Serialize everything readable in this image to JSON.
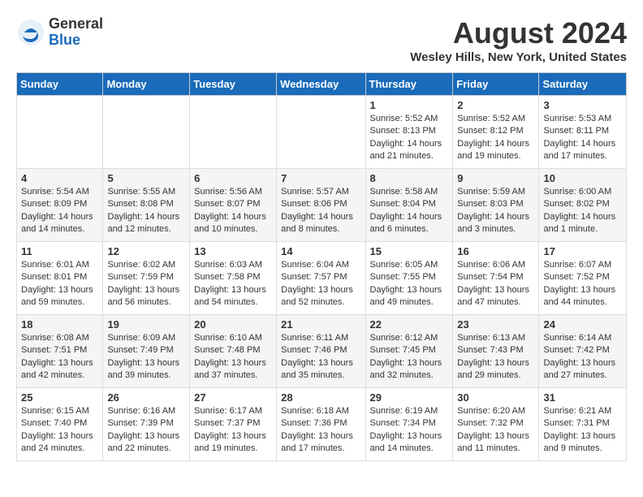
{
  "logo": {
    "general": "General",
    "blue": "Blue"
  },
  "title": "August 2024",
  "location": "Wesley Hills, New York, United States",
  "days_of_week": [
    "Sunday",
    "Monday",
    "Tuesday",
    "Wednesday",
    "Thursday",
    "Friday",
    "Saturday"
  ],
  "weeks": [
    [
      {
        "day": "",
        "content": ""
      },
      {
        "day": "",
        "content": ""
      },
      {
        "day": "",
        "content": ""
      },
      {
        "day": "",
        "content": ""
      },
      {
        "day": "1",
        "content": "Sunrise: 5:52 AM\nSunset: 8:13 PM\nDaylight: 14 hours and 21 minutes."
      },
      {
        "day": "2",
        "content": "Sunrise: 5:52 AM\nSunset: 8:12 PM\nDaylight: 14 hours and 19 minutes."
      },
      {
        "day": "3",
        "content": "Sunrise: 5:53 AM\nSunset: 8:11 PM\nDaylight: 14 hours and 17 minutes."
      }
    ],
    [
      {
        "day": "4",
        "content": "Sunrise: 5:54 AM\nSunset: 8:09 PM\nDaylight: 14 hours and 14 minutes."
      },
      {
        "day": "5",
        "content": "Sunrise: 5:55 AM\nSunset: 8:08 PM\nDaylight: 14 hours and 12 minutes."
      },
      {
        "day": "6",
        "content": "Sunrise: 5:56 AM\nSunset: 8:07 PM\nDaylight: 14 hours and 10 minutes."
      },
      {
        "day": "7",
        "content": "Sunrise: 5:57 AM\nSunset: 8:06 PM\nDaylight: 14 hours and 8 minutes."
      },
      {
        "day": "8",
        "content": "Sunrise: 5:58 AM\nSunset: 8:04 PM\nDaylight: 14 hours and 6 minutes."
      },
      {
        "day": "9",
        "content": "Sunrise: 5:59 AM\nSunset: 8:03 PM\nDaylight: 14 hours and 3 minutes."
      },
      {
        "day": "10",
        "content": "Sunrise: 6:00 AM\nSunset: 8:02 PM\nDaylight: 14 hours and 1 minute."
      }
    ],
    [
      {
        "day": "11",
        "content": "Sunrise: 6:01 AM\nSunset: 8:01 PM\nDaylight: 13 hours and 59 minutes."
      },
      {
        "day": "12",
        "content": "Sunrise: 6:02 AM\nSunset: 7:59 PM\nDaylight: 13 hours and 56 minutes."
      },
      {
        "day": "13",
        "content": "Sunrise: 6:03 AM\nSunset: 7:58 PM\nDaylight: 13 hours and 54 minutes."
      },
      {
        "day": "14",
        "content": "Sunrise: 6:04 AM\nSunset: 7:57 PM\nDaylight: 13 hours and 52 minutes."
      },
      {
        "day": "15",
        "content": "Sunrise: 6:05 AM\nSunset: 7:55 PM\nDaylight: 13 hours and 49 minutes."
      },
      {
        "day": "16",
        "content": "Sunrise: 6:06 AM\nSunset: 7:54 PM\nDaylight: 13 hours and 47 minutes."
      },
      {
        "day": "17",
        "content": "Sunrise: 6:07 AM\nSunset: 7:52 PM\nDaylight: 13 hours and 44 minutes."
      }
    ],
    [
      {
        "day": "18",
        "content": "Sunrise: 6:08 AM\nSunset: 7:51 PM\nDaylight: 13 hours and 42 minutes."
      },
      {
        "day": "19",
        "content": "Sunrise: 6:09 AM\nSunset: 7:49 PM\nDaylight: 13 hours and 39 minutes."
      },
      {
        "day": "20",
        "content": "Sunrise: 6:10 AM\nSunset: 7:48 PM\nDaylight: 13 hours and 37 minutes."
      },
      {
        "day": "21",
        "content": "Sunrise: 6:11 AM\nSunset: 7:46 PM\nDaylight: 13 hours and 35 minutes."
      },
      {
        "day": "22",
        "content": "Sunrise: 6:12 AM\nSunset: 7:45 PM\nDaylight: 13 hours and 32 minutes."
      },
      {
        "day": "23",
        "content": "Sunrise: 6:13 AM\nSunset: 7:43 PM\nDaylight: 13 hours and 29 minutes."
      },
      {
        "day": "24",
        "content": "Sunrise: 6:14 AM\nSunset: 7:42 PM\nDaylight: 13 hours and 27 minutes."
      }
    ],
    [
      {
        "day": "25",
        "content": "Sunrise: 6:15 AM\nSunset: 7:40 PM\nDaylight: 13 hours and 24 minutes."
      },
      {
        "day": "26",
        "content": "Sunrise: 6:16 AM\nSunset: 7:39 PM\nDaylight: 13 hours and 22 minutes."
      },
      {
        "day": "27",
        "content": "Sunrise: 6:17 AM\nSunset: 7:37 PM\nDaylight: 13 hours and 19 minutes."
      },
      {
        "day": "28",
        "content": "Sunrise: 6:18 AM\nSunset: 7:36 PM\nDaylight: 13 hours and 17 minutes."
      },
      {
        "day": "29",
        "content": "Sunrise: 6:19 AM\nSunset: 7:34 PM\nDaylight: 13 hours and 14 minutes."
      },
      {
        "day": "30",
        "content": "Sunrise: 6:20 AM\nSunset: 7:32 PM\nDaylight: 13 hours and 11 minutes."
      },
      {
        "day": "31",
        "content": "Sunrise: 6:21 AM\nSunset: 7:31 PM\nDaylight: 13 hours and 9 minutes."
      }
    ]
  ]
}
